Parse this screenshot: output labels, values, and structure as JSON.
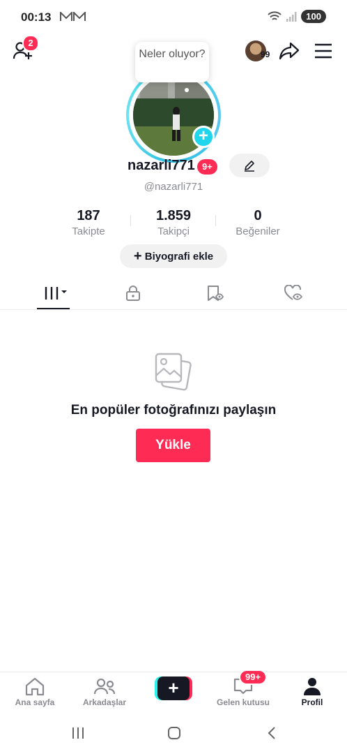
{
  "status_bar": {
    "time": "00:13",
    "battery": "100"
  },
  "top_bar": {
    "friend_requests_badge": "2",
    "avatar_count": "99"
  },
  "profile": {
    "tooltip": "Neler oluyor?",
    "username": "nazarli771",
    "level_badge": "9+",
    "handle": "@nazarli771",
    "stats": [
      {
        "value": "187",
        "label": "Takipte"
      },
      {
        "value": "1.859",
        "label": "Takipçi"
      },
      {
        "value": "0",
        "label": "Beğeniler"
      }
    ],
    "bio_button": "Biyografi ekle"
  },
  "tabs": [
    {
      "icon": "videos-grid-icon",
      "active": true
    },
    {
      "icon": "lock-icon",
      "active": false
    },
    {
      "icon": "favorites-icon",
      "active": false
    },
    {
      "icon": "liked-icon",
      "active": false
    }
  ],
  "empty_state": {
    "icon": "photo-icon",
    "title": "En popüler fotoğrafınızı paylaşın",
    "button": "Yükle"
  },
  "bottom_nav": {
    "home": "Ana sayfa",
    "friends": "Arkadaşlar",
    "inbox": "Gelen kutusu",
    "inbox_badge": "99+",
    "profile": "Profil"
  },
  "colors": {
    "accent": "#fe2c55",
    "cyan": "#25f4ee",
    "text": "#161823",
    "muted": "#8a8b91"
  }
}
